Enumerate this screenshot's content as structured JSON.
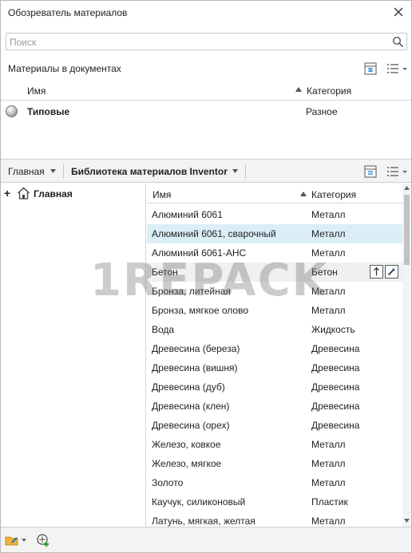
{
  "window": {
    "title": "Обозреватель материалов"
  },
  "search": {
    "placeholder": "Поиск"
  },
  "doc_materials": {
    "title": "Материалы в документах",
    "columns": {
      "name": "Имя",
      "category": "Категория"
    },
    "rows": [
      {
        "name": "Типовые",
        "category": "Разное"
      }
    ]
  },
  "library": {
    "home_label": "Главная",
    "library_name": "Библиотека материалов Inventor",
    "tree": {
      "home_label": "Главная",
      "expand_symbol": "+"
    },
    "columns": {
      "name": "Имя",
      "category": "Категория"
    },
    "rows": [
      {
        "name": "Алюминий 6061",
        "category": "Металл"
      },
      {
        "name": "Алюминий 6061, сварочный",
        "category": "Металл"
      },
      {
        "name": "Алюминий 6061-AHC",
        "category": "Металл"
      },
      {
        "name": "Бетон",
        "category": "Бетон"
      },
      {
        "name": "Бронза, литейная",
        "category": "Металл"
      },
      {
        "name": "Бронза, мягкое олово",
        "category": "Металл"
      },
      {
        "name": "Вода",
        "category": "Жидкость"
      },
      {
        "name": "Древесина (береза)",
        "category": "Древесина"
      },
      {
        "name": "Древесина (вишня)",
        "category": "Древесина"
      },
      {
        "name": "Древесина (дуб)",
        "category": "Древесина"
      },
      {
        "name": "Древесина (клен)",
        "category": "Древесина"
      },
      {
        "name": "Древесина (орех)",
        "category": "Древесина"
      },
      {
        "name": "Железо, ковкое",
        "category": "Металл"
      },
      {
        "name": "Железо, мягкое",
        "category": "Металл"
      },
      {
        "name": "Золото",
        "category": "Металл"
      },
      {
        "name": "Каучук, силиконовый",
        "category": "Пластик"
      },
      {
        "name": "Латунь, мягкая, желтая",
        "category": "Металл"
      }
    ],
    "selected_row": "Алюминий 6061, сварочный",
    "hovered_row": "Бетон"
  },
  "watermark": "1REPACK",
  "colors": {
    "selection": "#dbeef8",
    "hover": "#f0f0f0",
    "toolbar_bg": "#f3f3f3",
    "accent_blue": "#1f6fbf"
  }
}
